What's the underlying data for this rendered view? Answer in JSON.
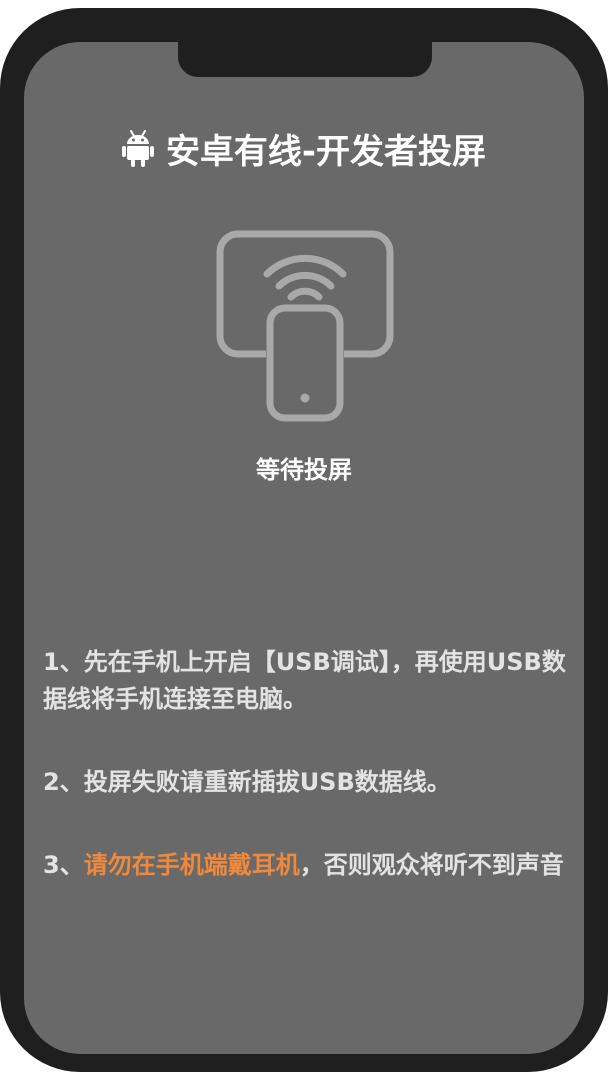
{
  "header": {
    "icon": "android-icon",
    "title": "安卓有线-开发者投屏"
  },
  "status": {
    "icon": "screen-cast-icon",
    "text": "等待投屏"
  },
  "instructions": {
    "step1": "1、先在手机上开启【USB调试】，再使用USB数据线将手机连接至电脑。",
    "step2": "2、投屏失败请重新插拔USB数据线。",
    "step3_prefix": "3、",
    "step3_highlight": "请勿在手机端戴耳机",
    "step3_suffix": "，否则观众将听不到声音"
  },
  "colors": {
    "frame": "#1f1f1f",
    "screen": "#696969",
    "highlight": "#f0893b",
    "icon_stroke": "#a9a9a9"
  }
}
